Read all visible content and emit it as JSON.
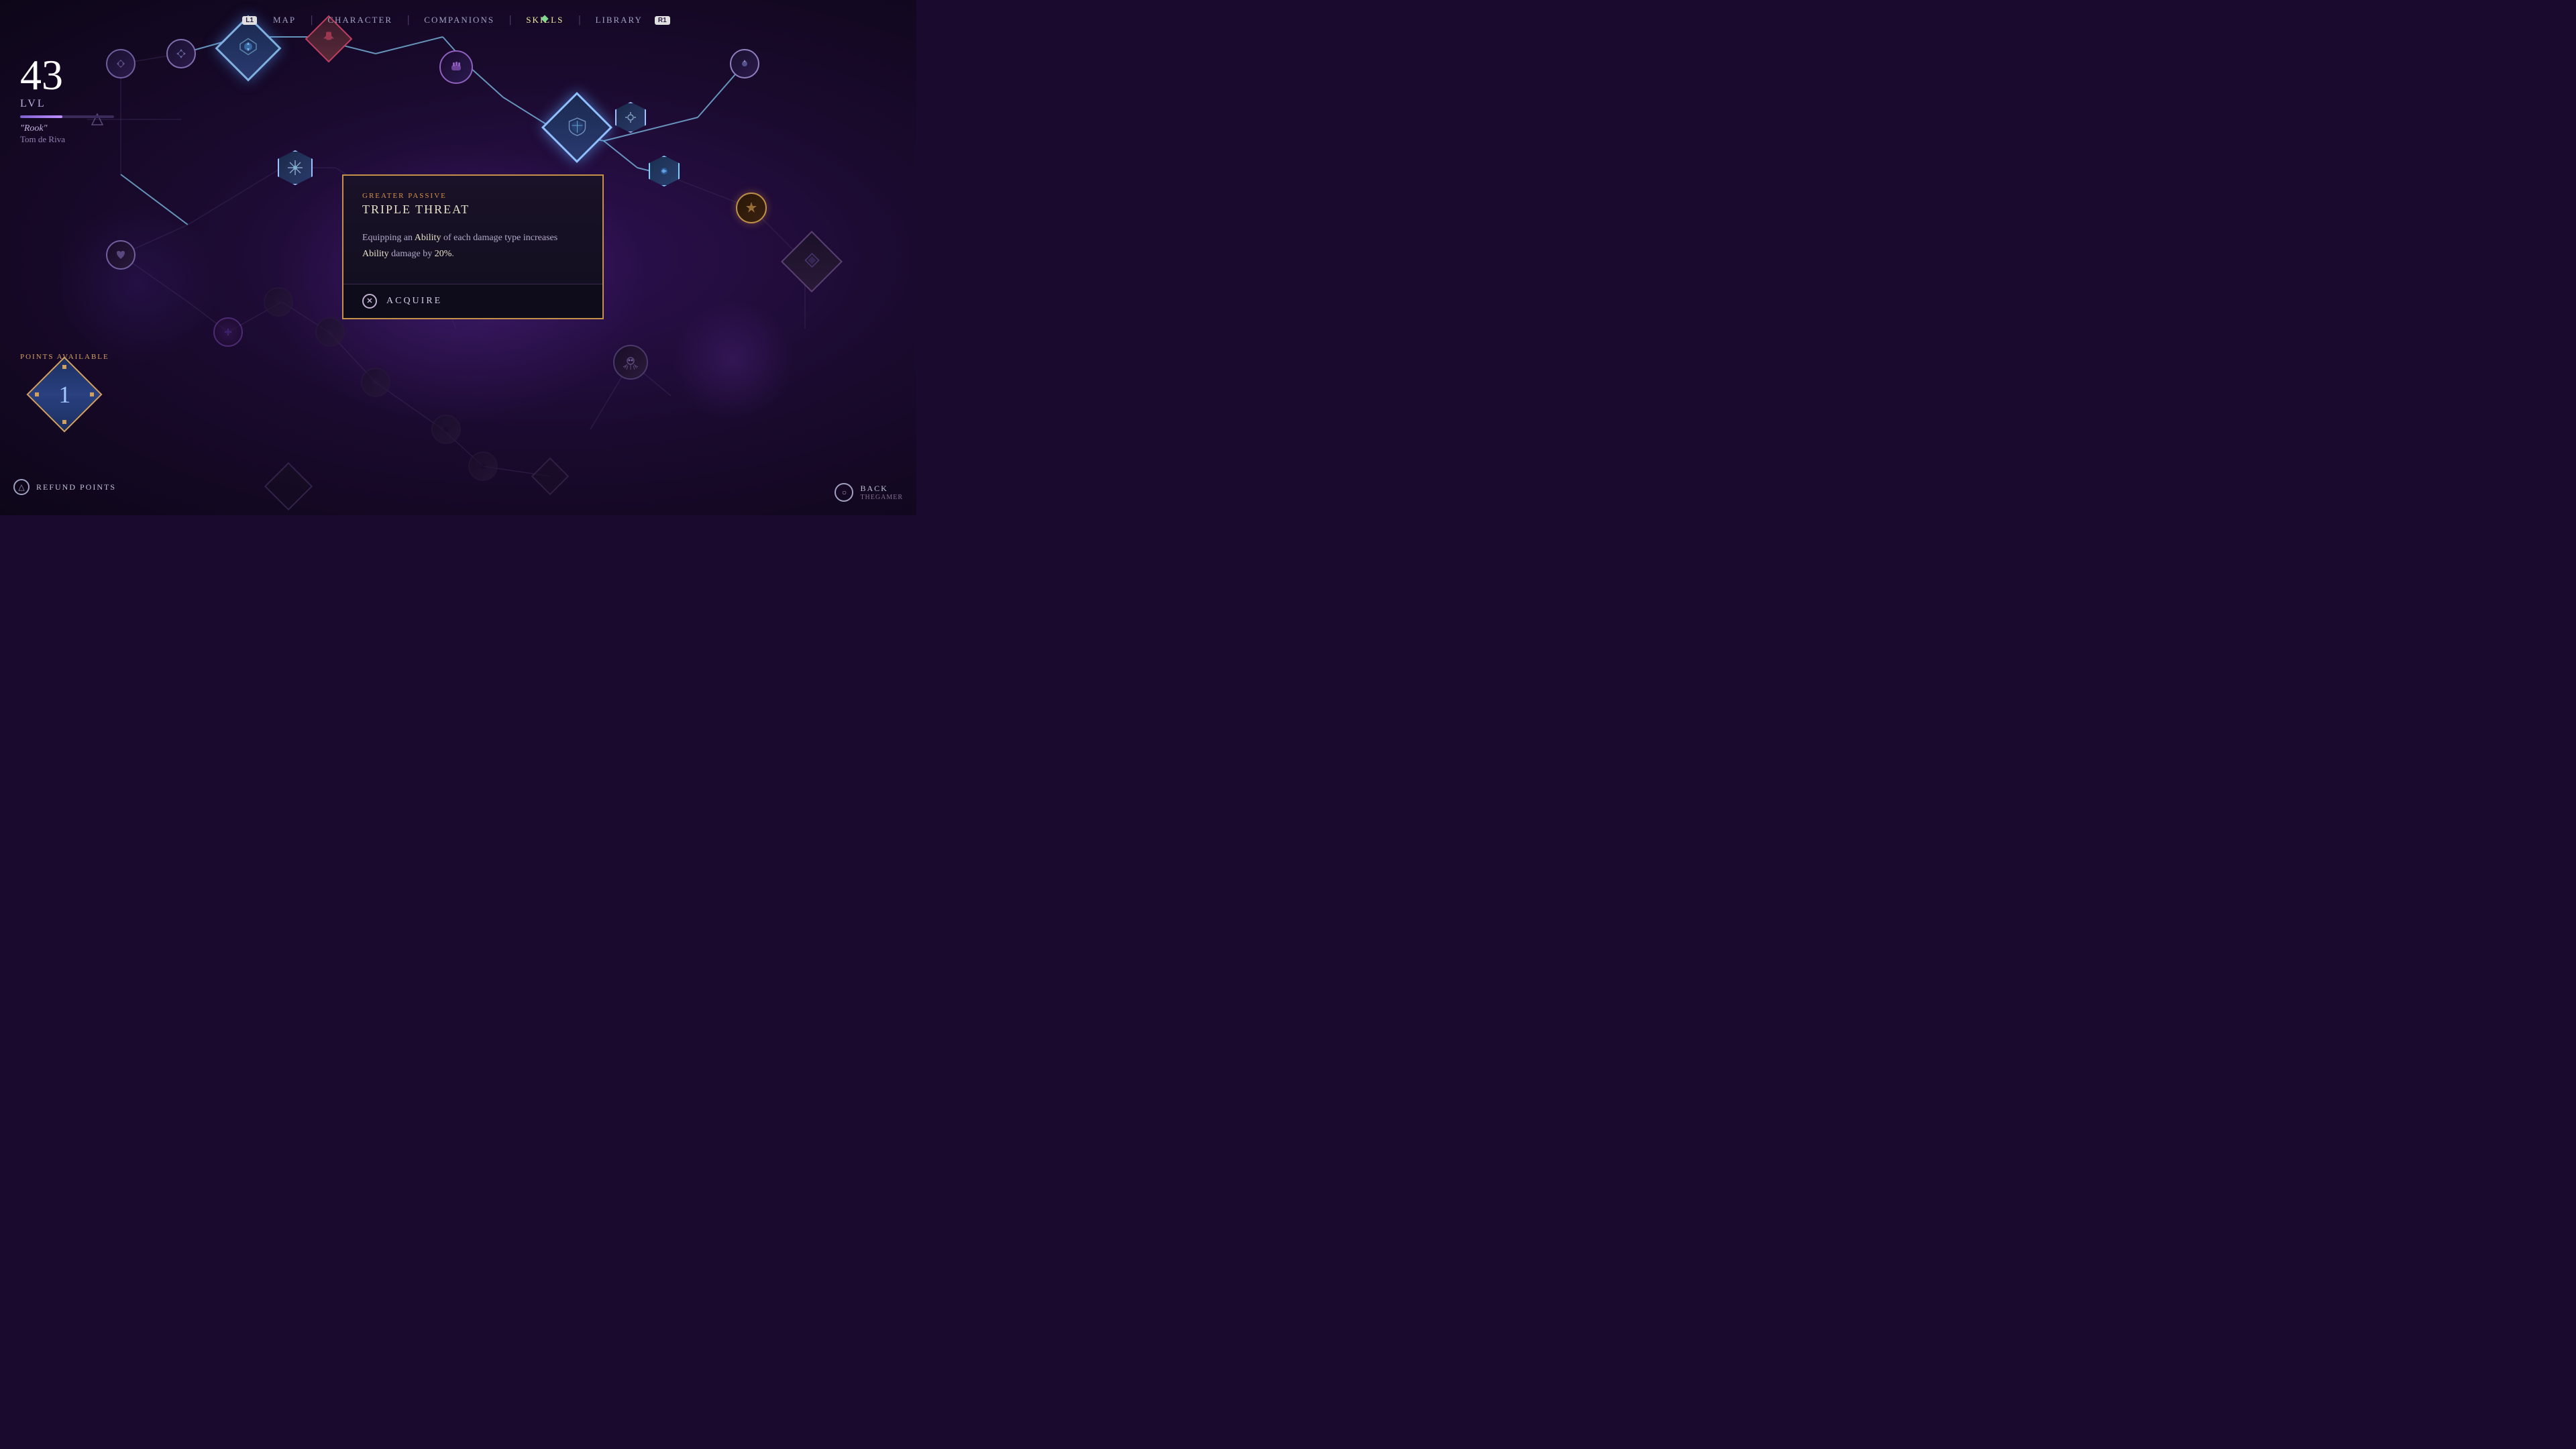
{
  "nav": {
    "items": [
      {
        "id": "map",
        "label": "MAP",
        "active": false,
        "badge": "L1"
      },
      {
        "id": "character",
        "label": "CHARACTER",
        "active": false
      },
      {
        "id": "companions",
        "label": "COMPANIONS",
        "active": false
      },
      {
        "id": "skills",
        "label": "SKILLS",
        "active": true
      },
      {
        "id": "library",
        "label": "LIBRARY",
        "active": false,
        "badge": "R1"
      }
    ],
    "separators": [
      "|",
      "|",
      "|",
      "|"
    ]
  },
  "character": {
    "level": "43",
    "lvl_label": "LVL",
    "name": "\"Rook\"",
    "subname": "Tom de Riva"
  },
  "points": {
    "label": "POINTS\nAVAILABLE",
    "count": "1"
  },
  "refund": {
    "icon": "△",
    "label": "REFUND POINTS"
  },
  "popup": {
    "type": "GREATER PASSIVE",
    "title": "TRIPLE THREAT",
    "description_parts": [
      {
        "text": "Equipping an ",
        "bold": false
      },
      {
        "text": "Ability",
        "bold": true
      },
      {
        "text": " of each damage type increases ",
        "bold": false
      },
      {
        "text": "Ability",
        "bold": true
      },
      {
        "text": " damage by ",
        "bold": false
      },
      {
        "text": "20%",
        "bold": true
      },
      {
        "text": ".",
        "bold": false
      }
    ],
    "acquire_label": "ACQUIRE",
    "acquire_icon": "✕"
  },
  "back": {
    "icon": "○",
    "label": "BACK",
    "sublabel": "THEGAMER"
  },
  "colors": {
    "accent_gold": "#d4904a",
    "accent_blue": "#7ab8e0",
    "accent_purple": "#9060d0",
    "nav_active": "#f0e8a0",
    "bg_dark": "#100818"
  }
}
